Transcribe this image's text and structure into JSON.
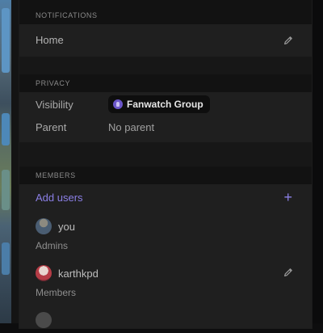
{
  "notifications": {
    "header": "NOTIFICATIONS",
    "value": "Home"
  },
  "privacy": {
    "header": "PRIVACY",
    "visibility_label": "Visibility",
    "visibility_value": "Fanwatch Group",
    "parent_label": "Parent",
    "parent_value": "No parent"
  },
  "members": {
    "header": "MEMBERS",
    "add_label": "Add users",
    "add_icon": "+",
    "list": [
      {
        "name": "you",
        "role": "Admins",
        "avatar": "user-avatar"
      },
      {
        "name": "karthkpd",
        "role": "Members",
        "avatar": "user-avatar"
      },
      {
        "name": "",
        "role": "",
        "avatar": "user-avatar"
      }
    ]
  },
  "colors": {
    "accent": "#8b7fe6",
    "panel": "#121212",
    "card": "#1f1f1f"
  },
  "icons": {
    "edit": "pencil-icon",
    "group": "group-icon",
    "add": "plus-icon"
  }
}
